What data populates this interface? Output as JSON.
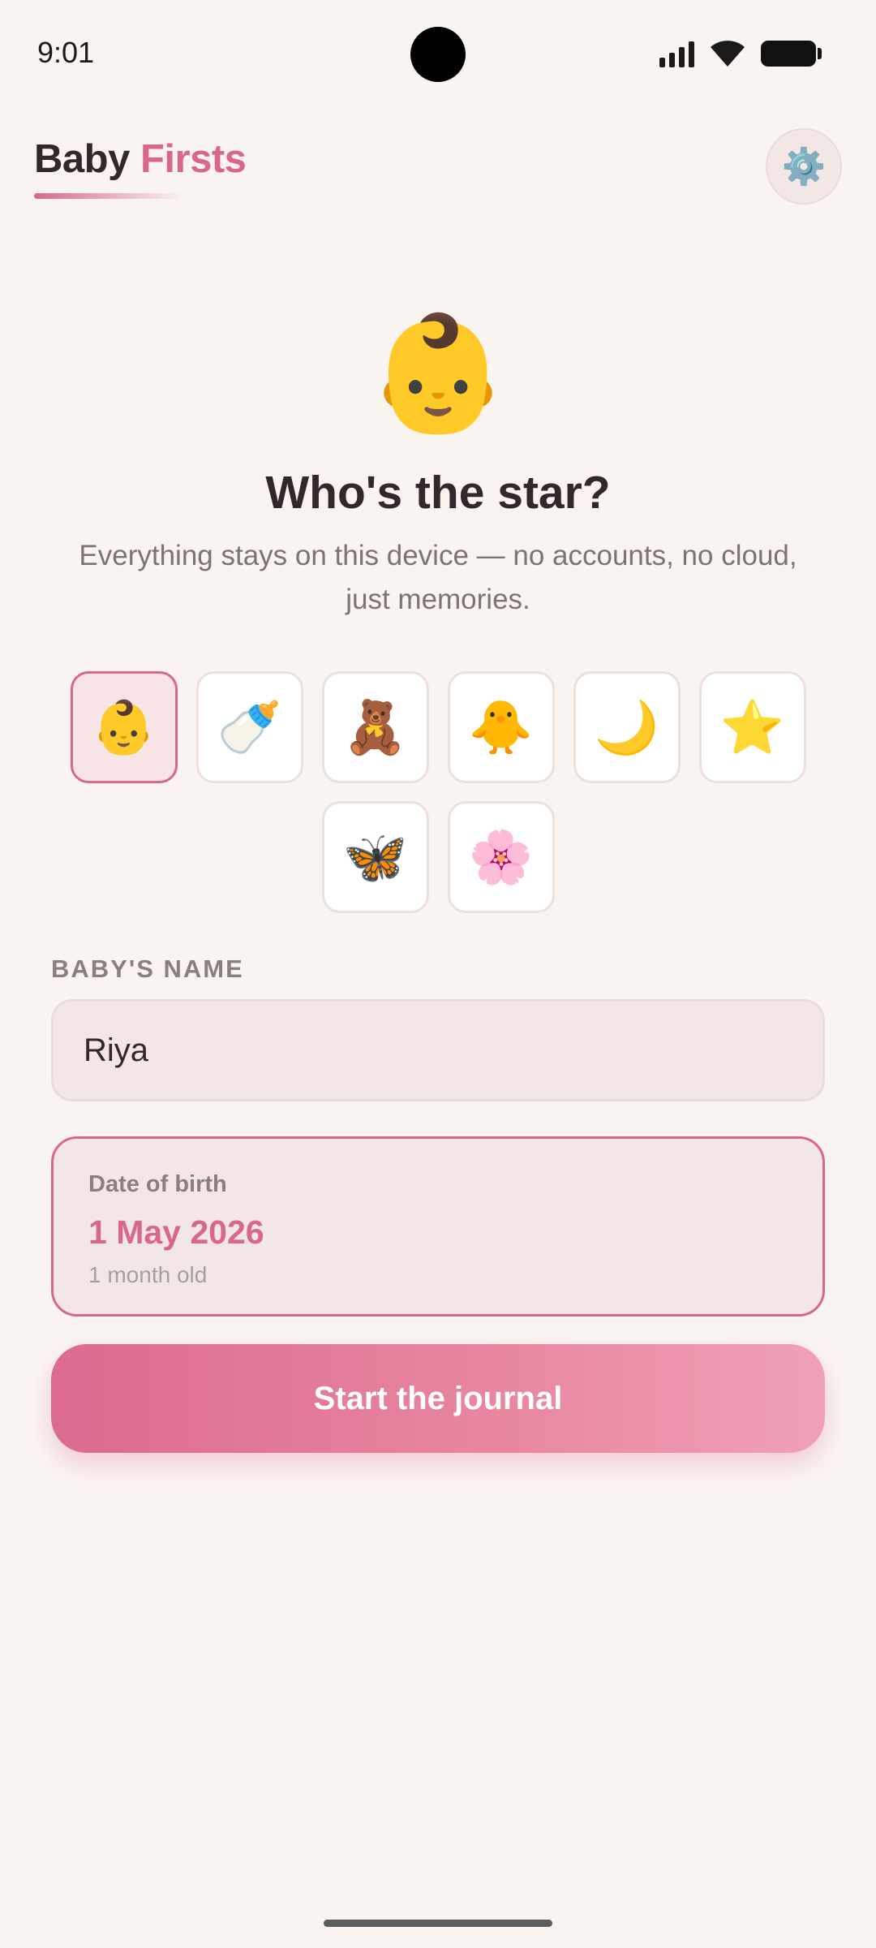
{
  "status_bar": {
    "time": "9:01",
    "icons": [
      "signal-icon",
      "wifi-icon",
      "battery-icon"
    ]
  },
  "header": {
    "title_part1": "Baby",
    "title_part2": "Firsts",
    "settings_icon": "⚙️"
  },
  "hero": {
    "emoji": "👶",
    "title": "Who's the star?",
    "subtitle": "Everything stays on this device — no accounts, no cloud, just memories."
  },
  "avatars": {
    "selected": "baby",
    "options": [
      {
        "id": "baby",
        "emoji": "👶"
      },
      {
        "id": "bottle",
        "emoji": "🍼"
      },
      {
        "id": "teddy",
        "emoji": "🧸"
      },
      {
        "id": "chick",
        "emoji": "🐥"
      },
      {
        "id": "moon",
        "emoji": "🌙"
      },
      {
        "id": "star",
        "emoji": "⭐"
      },
      {
        "id": "butterfly",
        "emoji": "🦋"
      },
      {
        "id": "blossom",
        "emoji": "🌸"
      }
    ]
  },
  "name_field": {
    "label": "BABY'S NAME",
    "value": "Riya"
  },
  "dob": {
    "label": "Date of birth",
    "value": "1 May 2026",
    "age": "1 month old"
  },
  "start_button": {
    "label": "Start the journal"
  },
  "colors": {
    "accent": "#d9678c",
    "background": "#faf4f1",
    "text": "#33272c"
  }
}
